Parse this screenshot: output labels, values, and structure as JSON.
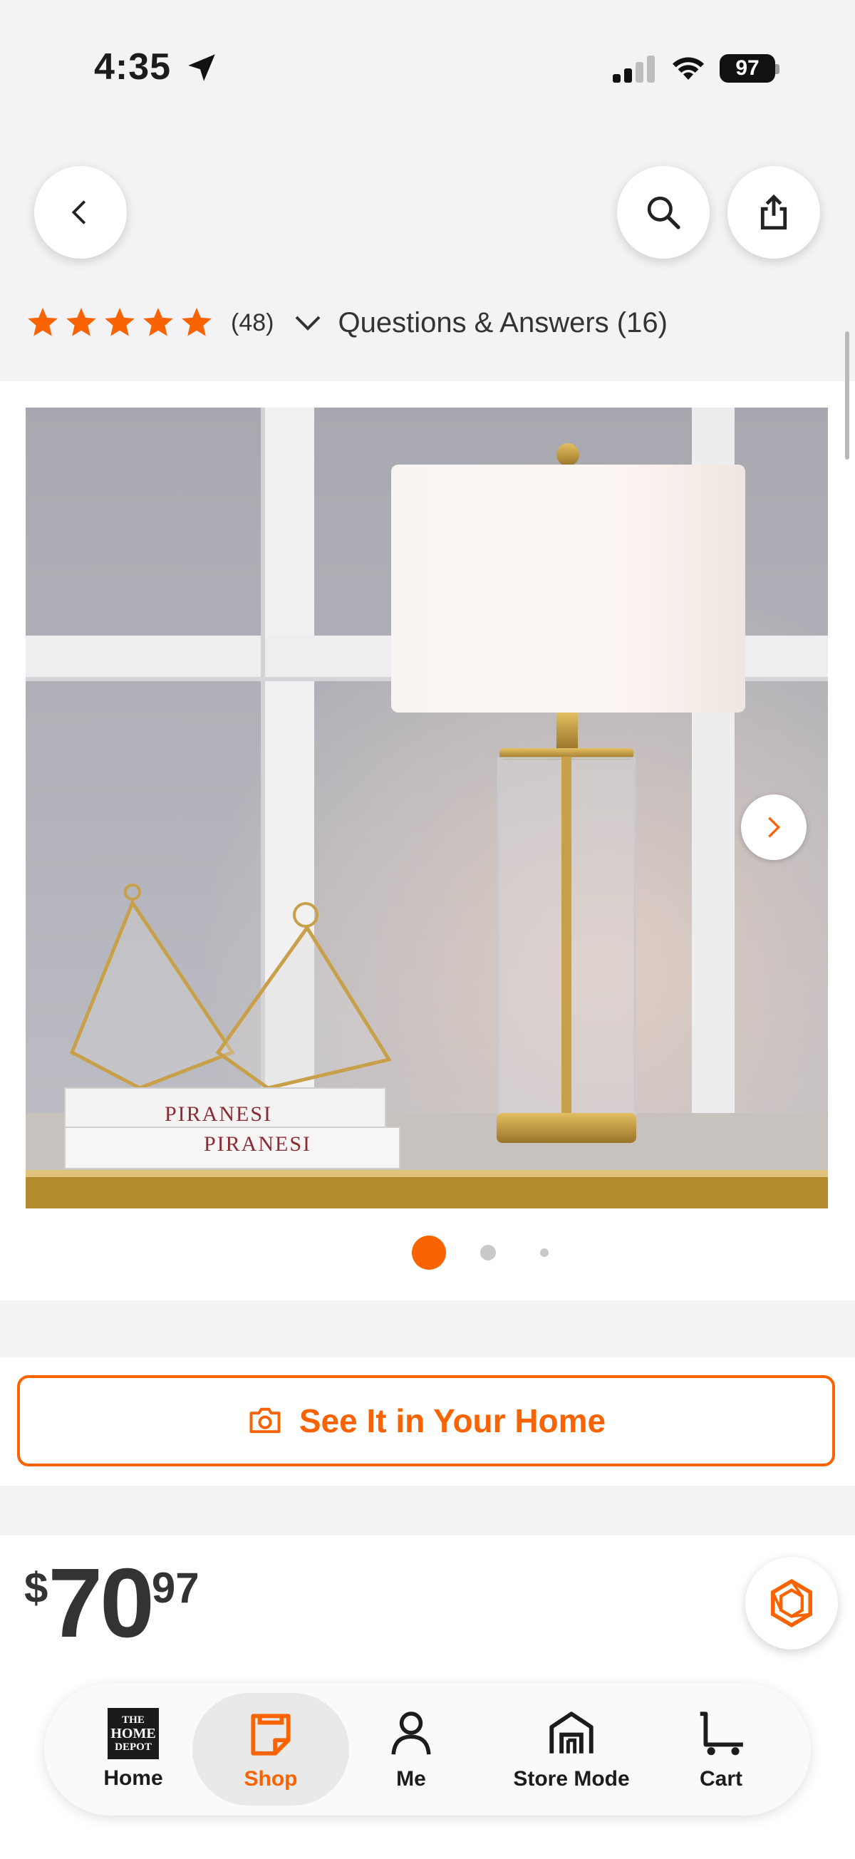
{
  "status_bar": {
    "time": "4:35",
    "battery": "97"
  },
  "rating": {
    "stars": 5,
    "count": "(48)",
    "qa_link": "Questions & Answers (16)"
  },
  "gallery": {
    "book_title_1": "PIRANESI",
    "book_title_2": "PIRANESI",
    "current_image": 1,
    "total_dots": 3
  },
  "ar_button": {
    "label": "See It in Your Home"
  },
  "price": {
    "symbol": "$",
    "dollars": "70",
    "cents": "97"
  },
  "nav": {
    "items": [
      {
        "label": "Home",
        "icon": "home-depot-logo-icon"
      },
      {
        "label": "Shop",
        "icon": "shop-bag-icon"
      },
      {
        "label": "Me",
        "icon": "person-icon"
      },
      {
        "label": "Store Mode",
        "icon": "store-icon"
      },
      {
        "label": "Cart",
        "icon": "cart-icon"
      }
    ],
    "active": "Shop"
  },
  "colors": {
    "brand_orange": "#f96302",
    "text_dark": "#1c1c1c"
  }
}
